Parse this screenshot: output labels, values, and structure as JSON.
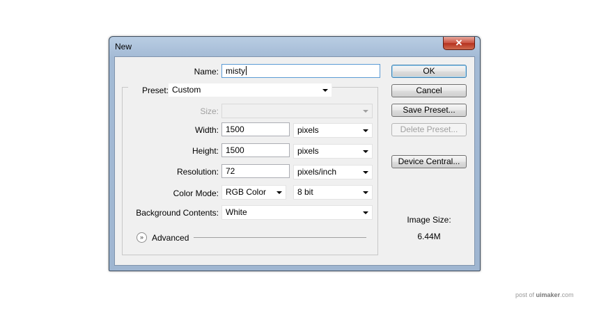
{
  "window": {
    "title": "New",
    "close_glyph": "✕",
    "close_icon": "close-icon"
  },
  "form": {
    "name_label": "Name:",
    "name_value": "misty",
    "preset_label": "Preset:",
    "preset_value": "Custom",
    "size_label": "Size:",
    "size_value": "",
    "width_label": "Width:",
    "width_value": "1500",
    "width_unit": "pixels",
    "height_label": "Height:",
    "height_value": "1500",
    "height_unit": "pixels",
    "resolution_label": "Resolution:",
    "resolution_value": "72",
    "resolution_unit": "pixels/inch",
    "color_mode_label": "Color Mode:",
    "color_mode_value": "RGB Color",
    "bit_depth_value": "8 bit",
    "background_label": "Background Contents:",
    "background_value": "White",
    "advanced_label": "Advanced",
    "advanced_icon": "chevron-double-down-icon"
  },
  "buttons": {
    "ok": "OK",
    "cancel": "Cancel",
    "save_preset": "Save Preset...",
    "delete_preset": "Delete Preset...",
    "device_central": "Device Central..."
  },
  "info": {
    "image_size_label": "Image Size:",
    "image_size_value": "6.44M"
  },
  "watermark": {
    "prefix": "post of",
    "brand": "uimaker",
    "suffix": ".com"
  },
  "colors": {
    "title_bar": "#a3bad5",
    "close_button": "#c9503e",
    "client_bg": "#f0f0f0",
    "default_button_border": "#3c7fb1"
  }
}
